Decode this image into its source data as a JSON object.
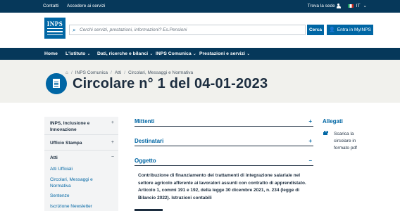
{
  "topbar": {
    "contatti": "Contatti",
    "accedere": "Accedere ai servizi",
    "trova_sede": "Trova la sede",
    "lang": "IT",
    "chevron": "⌄"
  },
  "header": {
    "logo_text": "INPS",
    "search_placeholder": "Cerchi servizi, prestazioni, informazioni? Es.Pensioni",
    "search_button": "Cerca",
    "myinps_button": "Entra in MyINPS"
  },
  "nav": {
    "items": [
      {
        "label": "Home",
        "chevron": ""
      },
      {
        "label": "L'istituto",
        "chevron": "⌄"
      },
      {
        "label": "Dati, ricerche e bilanci",
        "chevron": "⌄"
      },
      {
        "label": "INPS Comunica",
        "chevron": "⌄"
      },
      {
        "label": "Prestazioni e servizi",
        "chevron": "⌄"
      }
    ]
  },
  "breadcrumb": {
    "home_icon": "home-icon",
    "items": [
      "INPS Comunica",
      "Atti",
      "Circolari, Messaggi e Normativa"
    ]
  },
  "page_title": "Circolare n° 1 del 04-01-2023",
  "sidebar": {
    "sections": [
      {
        "label": "INPS, Inclusione e Innovazione",
        "toggle": "+"
      },
      {
        "label": "Ufficio Stampa",
        "toggle": "+"
      },
      {
        "label": "Atti",
        "toggle": "−"
      }
    ],
    "subitems": [
      "Atti Ufficiali",
      "Circolari, Messaggi e Normativa",
      "Sentenze",
      "Iscrizione Newsletter"
    ]
  },
  "main": {
    "accordions": [
      {
        "label": "Mittenti",
        "toggle": "+"
      },
      {
        "label": "Destinatari",
        "toggle": "+"
      },
      {
        "label": "Oggetto",
        "toggle": "−"
      }
    ],
    "oggetto_text": "Contribuzione di finanziamento dei trattamenti di integrazione salariale nel settore agricolo afferente ai lavoratori assunti con contratto di apprendistato. Articolo 1, commi 191 e 192, della legge 30 dicembre 2021, n. 234 (legge di Bilancio 2022). Istruzioni contabili"
  },
  "allegati": {
    "title": "Allegati",
    "link": "Scarica la circolare in formato pdf"
  },
  "colors": {
    "navy": "#06385a",
    "blue": "#0066a4",
    "hero_bg": "#f1f1ed",
    "sidebar_bg": "#f3f4f5"
  }
}
